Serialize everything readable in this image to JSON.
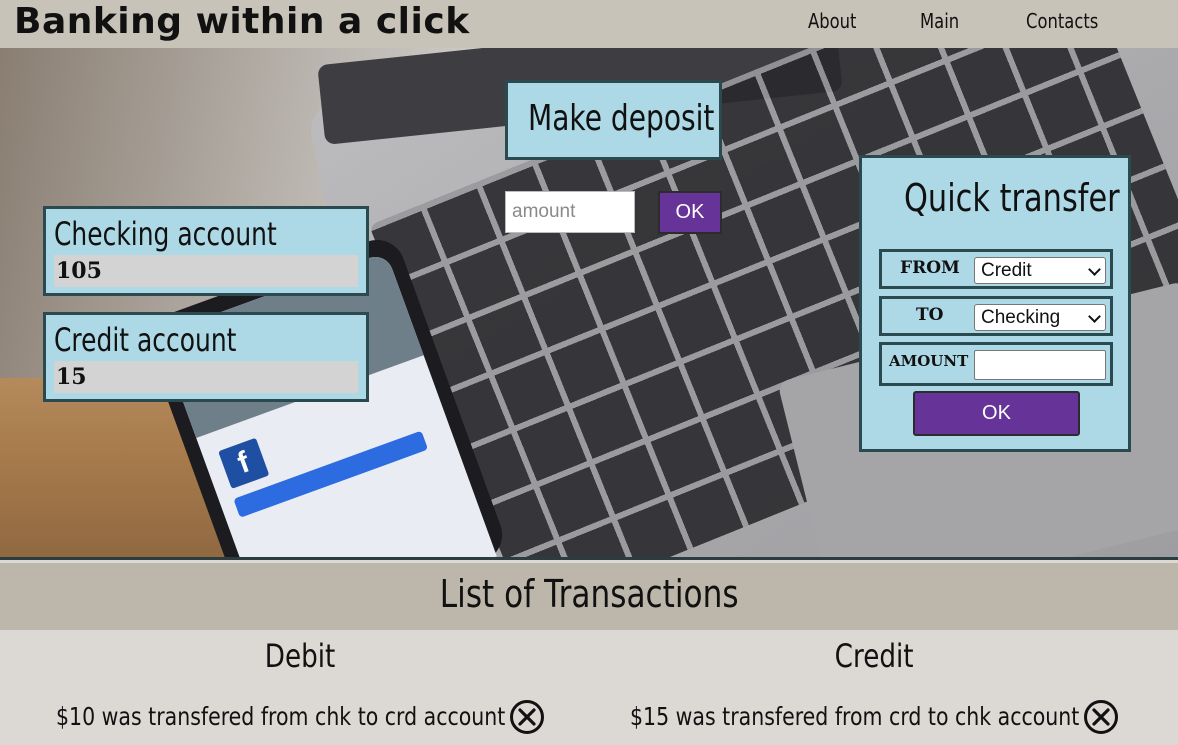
{
  "header": {
    "brand": "Banking within a click",
    "nav": [
      {
        "label": "About"
      },
      {
        "label": "Main"
      },
      {
        "label": "Contacts"
      }
    ]
  },
  "accounts": {
    "checking": {
      "title": "Checking account",
      "value": "105"
    },
    "credit": {
      "title": "Credit account",
      "value": "15"
    }
  },
  "deposit": {
    "title": "Make deposit",
    "placeholder": "amount",
    "ok_label": "OK"
  },
  "quick_transfer": {
    "title": "Quick transfer",
    "from_label": "FROM",
    "from_value": "Credit",
    "to_label": "TO",
    "to_value": "Checking",
    "amount_label": "AMOUNT",
    "ok_label": "OK"
  },
  "transactions": {
    "title": "List of Transactions",
    "debit": {
      "title": "Debit",
      "items": [
        {
          "text": "$10 was transfered from chk to crd account"
        }
      ]
    },
    "credit": {
      "title": "Credit",
      "items": [
        {
          "text": "$15 was transfered from crd to chk account"
        }
      ]
    }
  },
  "colors": {
    "panel": "#add8e6",
    "panel_border": "#2b4a50",
    "button": "#663399",
    "header_bg": "#c8c3b8",
    "tx_header_bg": "#bdb7ab",
    "tx_bg": "#dcd9d4"
  },
  "icons": {
    "remove": "circle-x-icon",
    "chevron": "chevron-down-icon"
  }
}
